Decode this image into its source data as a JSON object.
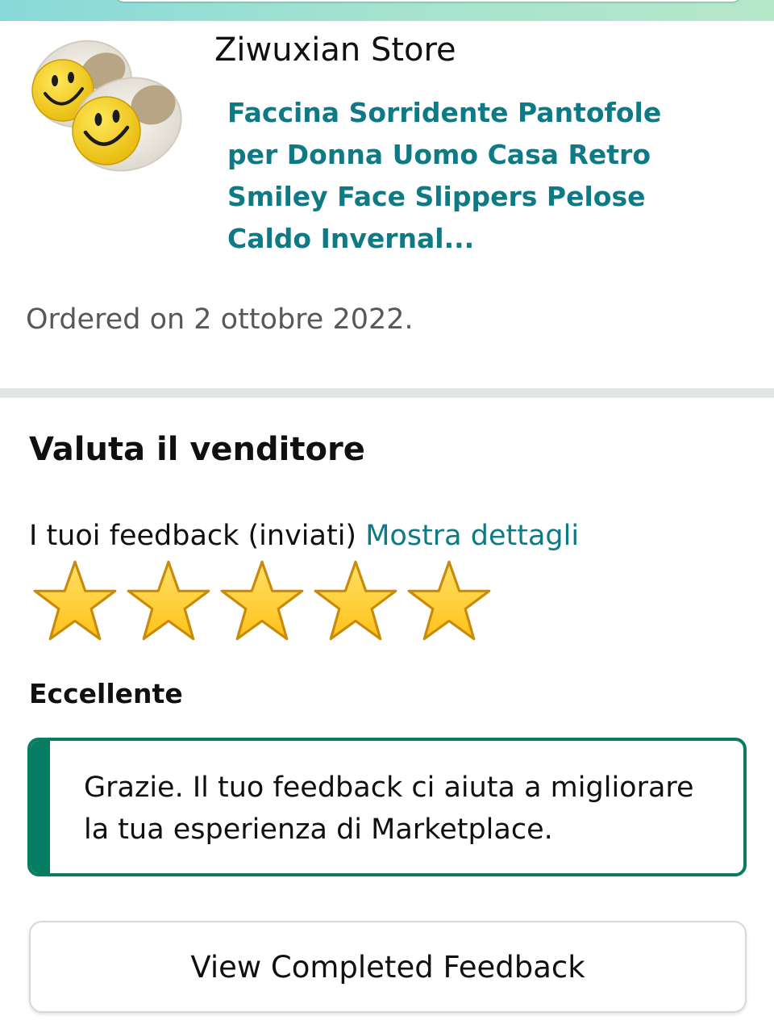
{
  "order": {
    "store_name": "Ziwuxian Store",
    "product_title": "Faccina Sorridente Pantofole per Donna Uomo Casa Retro Smiley Face Slippers Pelose Caldo Invernal...",
    "ordered_text": "Ordered on 2 ottobre 2022."
  },
  "rating_section": {
    "title": "Valuta il venditore",
    "feedback_label": "I tuoi feedback (inviati)",
    "details_link": "Mostra dettagli",
    "stars": {
      "filled": 5,
      "total": 5
    },
    "rating_word": "Eccellente"
  },
  "alert": {
    "message": "Grazie. Il tuo feedback ci aiuta a migliorare la tua esperienza di Marketplace."
  },
  "actions": {
    "view_feedback_label": "View Completed Feedback"
  },
  "colors": {
    "accent_link": "#0e7a85",
    "success_green": "#067d62",
    "star_gold": "#ffc21a"
  },
  "icons": {
    "product_image": "smiley-slippers-image",
    "star": "star-icon"
  }
}
